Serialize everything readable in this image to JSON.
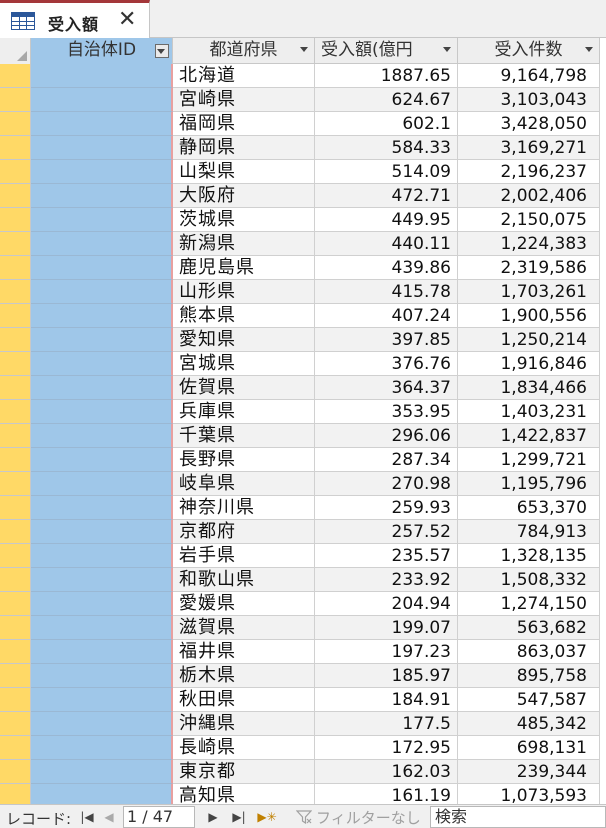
{
  "tab": {
    "title": "受入額",
    "close": "✕",
    "icon": "table-icon"
  },
  "columns": [
    {
      "label": "自治体ID"
    },
    {
      "label": "都道府県"
    },
    {
      "label": "受入額(億円"
    },
    {
      "label": "受入件数"
    }
  ],
  "rows": [
    {
      "pref": "北海道",
      "amount": "1887.65",
      "count": "9,164,798"
    },
    {
      "pref": "宮崎県",
      "amount": "624.67",
      "count": "3,103,043"
    },
    {
      "pref": "福岡県",
      "amount": "602.1",
      "count": "3,428,050"
    },
    {
      "pref": "静岡県",
      "amount": "584.33",
      "count": "3,169,271"
    },
    {
      "pref": "山梨県",
      "amount": "514.09",
      "count": "2,196,237"
    },
    {
      "pref": "大阪府",
      "amount": "472.71",
      "count": "2,002,406"
    },
    {
      "pref": "茨城県",
      "amount": "449.95",
      "count": "2,150,075"
    },
    {
      "pref": "新潟県",
      "amount": "440.11",
      "count": "1,224,383"
    },
    {
      "pref": "鹿児島県",
      "amount": "439.86",
      "count": "2,319,586"
    },
    {
      "pref": "山形県",
      "amount": "415.78",
      "count": "1,703,261"
    },
    {
      "pref": "熊本県",
      "amount": "407.24",
      "count": "1,900,556"
    },
    {
      "pref": "愛知県",
      "amount": "397.85",
      "count": "1,250,214"
    },
    {
      "pref": "宮城県",
      "amount": "376.76",
      "count": "1,916,846"
    },
    {
      "pref": "佐賀県",
      "amount": "364.37",
      "count": "1,834,466"
    },
    {
      "pref": "兵庫県",
      "amount": "353.95",
      "count": "1,403,231"
    },
    {
      "pref": "千葉県",
      "amount": "296.06",
      "count": "1,422,837"
    },
    {
      "pref": "長野県",
      "amount": "287.34",
      "count": "1,299,721"
    },
    {
      "pref": "岐阜県",
      "amount": "270.98",
      "count": "1,195,796"
    },
    {
      "pref": "神奈川県",
      "amount": "259.93",
      "count": "653,370"
    },
    {
      "pref": "京都府",
      "amount": "257.52",
      "count": "784,913"
    },
    {
      "pref": "岩手県",
      "amount": "235.57",
      "count": "1,328,135"
    },
    {
      "pref": "和歌山県",
      "amount": "233.92",
      "count": "1,508,332"
    },
    {
      "pref": "愛媛県",
      "amount": "204.94",
      "count": "1,274,150"
    },
    {
      "pref": "滋賀県",
      "amount": "199.07",
      "count": "563,682"
    },
    {
      "pref": "福井県",
      "amount": "197.23",
      "count": "863,037"
    },
    {
      "pref": "栃木県",
      "amount": "185.97",
      "count": "895,758"
    },
    {
      "pref": "秋田県",
      "amount": "184.91",
      "count": "547,587"
    },
    {
      "pref": "沖縄県",
      "amount": "177.5",
      "count": "485,342"
    },
    {
      "pref": "長崎県",
      "amount": "172.95",
      "count": "698,131"
    },
    {
      "pref": "東京都",
      "amount": "162.03",
      "count": "239,344"
    },
    {
      "pref": "高知県",
      "amount": "161.19",
      "count": "1,073,593"
    }
  ],
  "nav": {
    "label": "レコード:",
    "first": "|◀",
    "prev": "◀",
    "position": "1 / 47",
    "next": "▶",
    "last": "▶|",
    "new": "▶✳",
    "filter": "フィルターなし",
    "search": "検索"
  },
  "colors": {
    "accent": "#a4373a",
    "selected_column": "#9fc7e9",
    "row_selector": "#ffd966"
  }
}
